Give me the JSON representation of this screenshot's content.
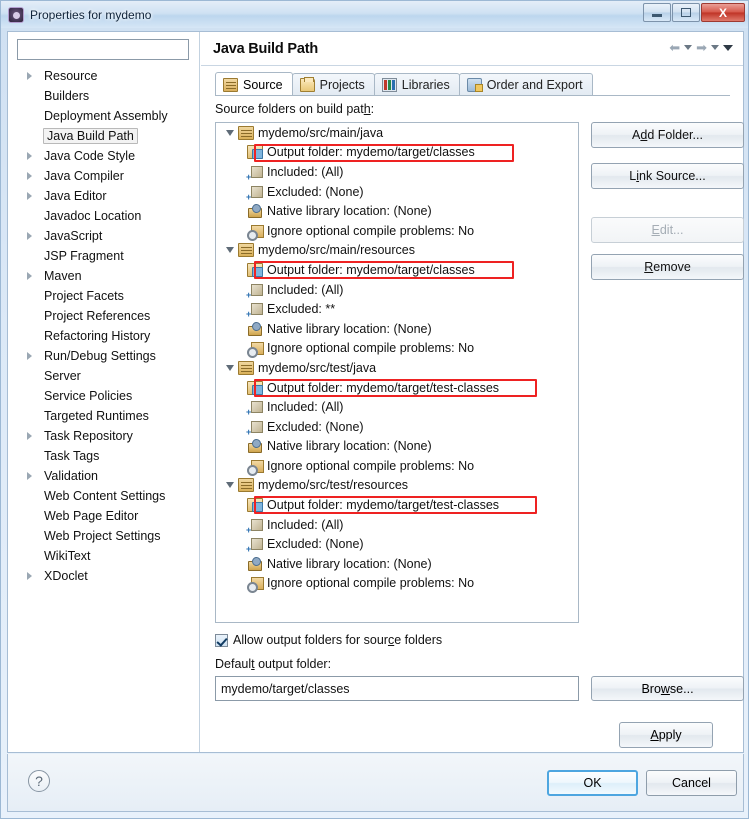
{
  "window": {
    "title": "Properties for mydemo",
    "app_icon": "properties-icon",
    "controls": {
      "minimize": "minimize-icon",
      "maximize": "restore-icon",
      "close": "X"
    }
  },
  "sidebar": {
    "filter_value": "",
    "filter_placeholder": "",
    "items": [
      {
        "label": "Resource",
        "expandable": true,
        "selected": false
      },
      {
        "label": "Builders",
        "expandable": false,
        "selected": false
      },
      {
        "label": "Deployment Assembly",
        "expandable": false,
        "selected": false
      },
      {
        "label": "Java Build Path",
        "expandable": false,
        "selected": true
      },
      {
        "label": "Java Code Style",
        "expandable": true,
        "selected": false
      },
      {
        "label": "Java Compiler",
        "expandable": true,
        "selected": false
      },
      {
        "label": "Java Editor",
        "expandable": true,
        "selected": false
      },
      {
        "label": "Javadoc Location",
        "expandable": false,
        "selected": false
      },
      {
        "label": "JavaScript",
        "expandable": true,
        "selected": false
      },
      {
        "label": "JSP Fragment",
        "expandable": false,
        "selected": false
      },
      {
        "label": "Maven",
        "expandable": true,
        "selected": false
      },
      {
        "label": "Project Facets",
        "expandable": false,
        "selected": false
      },
      {
        "label": "Project References",
        "expandable": false,
        "selected": false
      },
      {
        "label": "Refactoring History",
        "expandable": false,
        "selected": false
      },
      {
        "label": "Run/Debug Settings",
        "expandable": true,
        "selected": false
      },
      {
        "label": "Server",
        "expandable": false,
        "selected": false
      },
      {
        "label": "Service Policies",
        "expandable": false,
        "selected": false
      },
      {
        "label": "Targeted Runtimes",
        "expandable": false,
        "selected": false
      },
      {
        "label": "Task Repository",
        "expandable": true,
        "selected": false
      },
      {
        "label": "Task Tags",
        "expandable": false,
        "selected": false
      },
      {
        "label": "Validation",
        "expandable": true,
        "selected": false
      },
      {
        "label": "Web Content Settings",
        "expandable": false,
        "selected": false
      },
      {
        "label": "Web Page Editor",
        "expandable": false,
        "selected": false
      },
      {
        "label": "Web Project Settings",
        "expandable": false,
        "selected": false
      },
      {
        "label": "WikiText",
        "expandable": false,
        "selected": false
      },
      {
        "label": "XDoclet",
        "expandable": true,
        "selected": false
      }
    ]
  },
  "page": {
    "title": "Java Build Path",
    "nav": {
      "back": "back-arrow",
      "forward": "forward-arrow",
      "menu": "menu-arrow"
    }
  },
  "tabs": [
    {
      "label": "Source",
      "icon": "source-folder-icon",
      "active": true
    },
    {
      "label": "Projects",
      "icon": "projects-folder-icon",
      "active": false
    },
    {
      "label": "Libraries",
      "icon": "libraries-icon",
      "active": false
    },
    {
      "label": "Order and Export",
      "icon": "order-export-icon",
      "active": false
    }
  ],
  "source_tab": {
    "tree_label": "Source folders on build path:",
    "groups": [
      {
        "root": "mydemo/src/main/java",
        "children": [
          {
            "text": "Output folder: mydemo/target/classes",
            "icon": "output-folder-icon",
            "highlighted": true,
            "hl_width": 260
          },
          {
            "text": "Included: (All)",
            "icon": "inclusion-filter-icon",
            "highlighted": false
          },
          {
            "text": "Excluded: (None)",
            "icon": "exclusion-filter-icon",
            "highlighted": false
          },
          {
            "text": "Native library location: (None)",
            "icon": "native-library-icon",
            "highlighted": false
          },
          {
            "text": "Ignore optional compile problems: No",
            "icon": "ignore-problems-icon",
            "highlighted": false
          }
        ]
      },
      {
        "root": "mydemo/src/main/resources",
        "children": [
          {
            "text": "Output folder: mydemo/target/classes",
            "icon": "output-folder-icon",
            "highlighted": true,
            "hl_width": 260
          },
          {
            "text": "Included: (All)",
            "icon": "inclusion-filter-icon",
            "highlighted": false
          },
          {
            "text": "Excluded: **",
            "icon": "exclusion-filter-icon",
            "highlighted": false
          },
          {
            "text": "Native library location: (None)",
            "icon": "native-library-icon",
            "highlighted": false
          },
          {
            "text": "Ignore optional compile problems: No",
            "icon": "ignore-problems-icon",
            "highlighted": false
          }
        ]
      },
      {
        "root": "mydemo/src/test/java",
        "children": [
          {
            "text": "Output folder: mydemo/target/test-classes",
            "icon": "output-folder-icon",
            "highlighted": true,
            "hl_width": 283
          },
          {
            "text": "Included: (All)",
            "icon": "inclusion-filter-icon",
            "highlighted": false
          },
          {
            "text": "Excluded: (None)",
            "icon": "exclusion-filter-icon",
            "highlighted": false
          },
          {
            "text": "Native library location: (None)",
            "icon": "native-library-icon",
            "highlighted": false
          },
          {
            "text": "Ignore optional compile problems: No",
            "icon": "ignore-problems-icon",
            "highlighted": false
          }
        ]
      },
      {
        "root": "mydemo/src/test/resources",
        "children": [
          {
            "text": "Output folder: mydemo/target/test-classes",
            "icon": "output-folder-icon",
            "highlighted": true,
            "hl_width": 283
          },
          {
            "text": "Included: (All)",
            "icon": "inclusion-filter-icon",
            "highlighted": false
          },
          {
            "text": "Excluded: (None)",
            "icon": "exclusion-filter-icon",
            "highlighted": false
          },
          {
            "text": "Native library location: (None)",
            "icon": "native-library-icon",
            "highlighted": false
          },
          {
            "text": "Ignore optional compile problems: No",
            "icon": "ignore-problems-icon",
            "highlighted": false
          }
        ]
      }
    ],
    "buttons": [
      {
        "label": "Add Folder...",
        "mnemonic": "d",
        "enabled": true
      },
      {
        "label": "Link Source...",
        "mnemonic": "i",
        "enabled": true
      },
      {
        "label": "Edit...",
        "mnemonic": "E",
        "enabled": false
      },
      {
        "label": "Remove",
        "mnemonic": "R",
        "enabled": true
      }
    ],
    "allow_output_checkbox": {
      "label": "Allow output folders for source folders",
      "checked": true
    },
    "default_output_label": "Default output folder:",
    "default_output_value": "mydemo/target/classes",
    "browse_label": "Browse...",
    "apply_label": "Apply"
  },
  "footer": {
    "help": "?",
    "ok_label": "OK",
    "cancel_label": "Cancel"
  },
  "colors": {
    "highlight_red": "#ee2222",
    "title_bar": "#cfe1f3",
    "ok_focus_border": "#4ea6e0"
  }
}
